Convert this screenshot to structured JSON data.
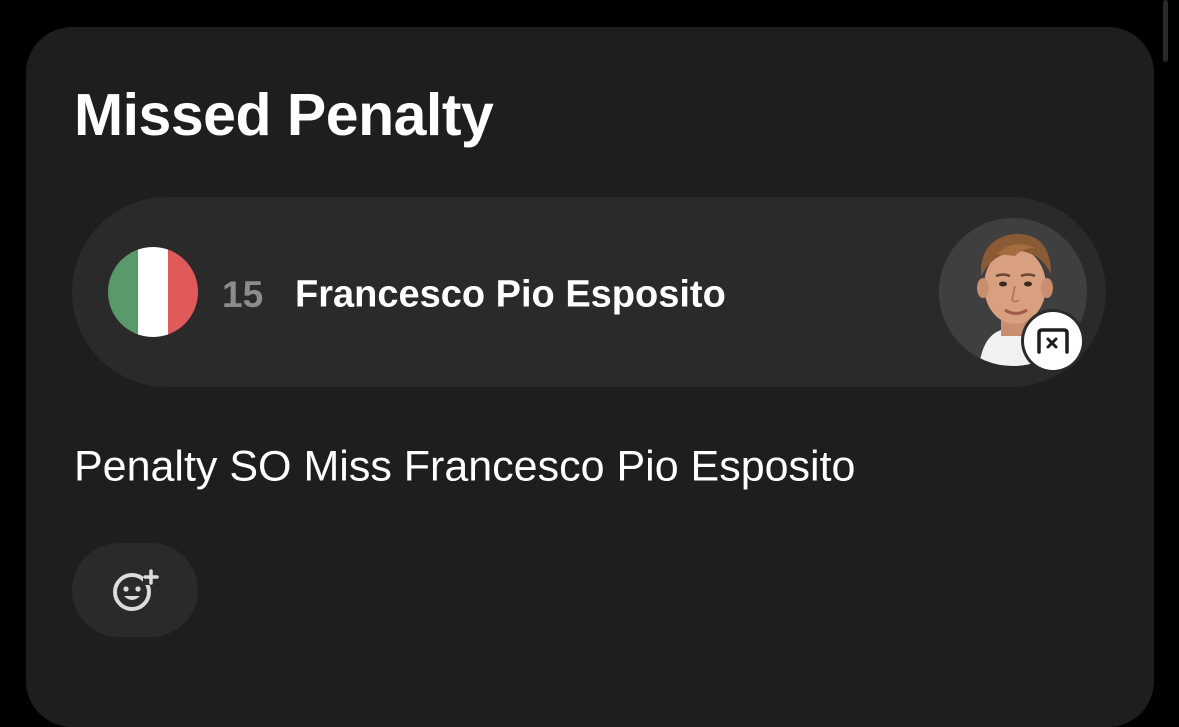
{
  "event": {
    "title": "Missed Penalty",
    "description": "Penalty SO Miss Francesco Pio Esposito"
  },
  "player": {
    "number": "15",
    "name": "Francesco Pio Esposito",
    "flag": "italy-flag",
    "flag_colors": [
      "#5a9a6a",
      "#ffffff",
      "#e05a5a"
    ],
    "avatar": "player-photo",
    "status_icon": "missed-goal-icon"
  },
  "actions": {
    "reaction_icon": "add-reaction-icon"
  },
  "colors": {
    "background": "#000000",
    "card": "#1e1e1e",
    "pill": "#2a2a2a",
    "muted_text": "#8c8c8c",
    "text": "#ffffff"
  }
}
